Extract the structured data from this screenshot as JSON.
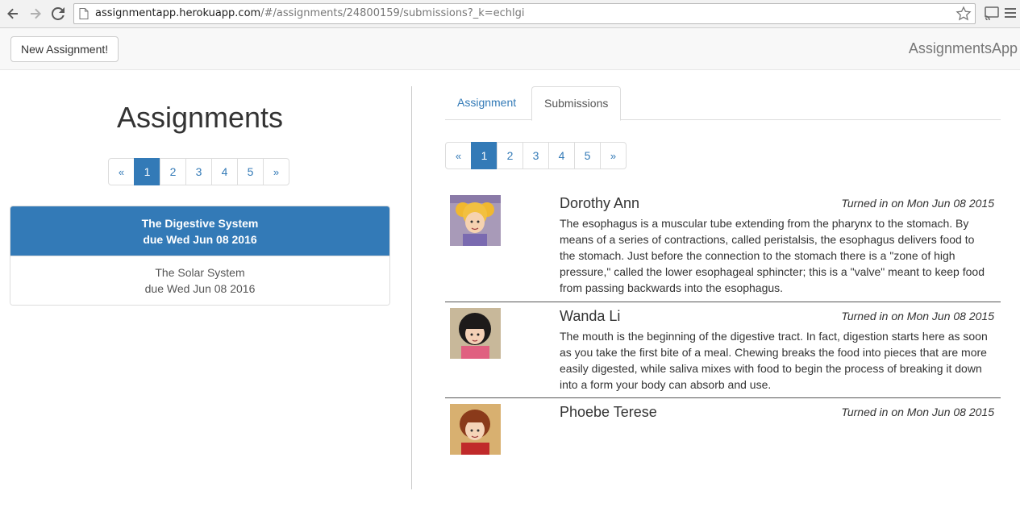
{
  "browser": {
    "url_host": "assignmentapp.herokuapp.com",
    "url_path": "/#/assignments/24800159/submissions?_k=echlgi"
  },
  "navbar": {
    "new_assignment_label": "New Assignment!",
    "brand": "AssignmentsApp"
  },
  "left": {
    "heading": "Assignments",
    "pagination": [
      "«",
      "1",
      "2",
      "3",
      "4",
      "5",
      "»"
    ],
    "active_page": "1",
    "assignments": [
      {
        "title": "The Digestive System",
        "due": "due Wed Jun 08 2016",
        "active": true
      },
      {
        "title": "The Solar System",
        "due": "due Wed Jun 08 2016",
        "active": false
      }
    ]
  },
  "right": {
    "tabs": [
      {
        "label": "Assignment",
        "active": false
      },
      {
        "label": "Submissions",
        "active": true
      }
    ],
    "pagination": [
      "«",
      "1",
      "2",
      "3",
      "4",
      "5",
      "»"
    ],
    "submissions": [
      {
        "name": "Dorothy Ann",
        "turned_in": "Turned in on Mon Jun 08 2015",
        "text_lines": [
          "The esophagus is a muscular tube extending from the pharynx to the stomach. By",
          "means of a series of contractions, called peristalsis, the esophagus delivers food to",
          "the stomach. Just before the connection to the stomach there is a \"zone of high",
          "pressure,\" called the lower esophageal sphincter; this is a \"valve\" meant to keep food",
          "from passing backwards into the esophagus."
        ]
      },
      {
        "name": "Wanda Li",
        "turned_in": "Turned in on Mon Jun 08 2015",
        "text_lines": [
          "The mouth is the beginning of the digestive tract. In fact, digestion starts here as soon",
          "as you take the first bite of a meal. Chewing breaks the food into pieces that are more",
          "easily digested, while saliva mixes with food to begin the process of breaking it down",
          "into a form your body can absorb and use."
        ]
      },
      {
        "name": "Phoebe Terese",
        "turned_in": "Turned in on Mon Jun 08 2015",
        "text_lines": []
      }
    ]
  },
  "colors": {
    "primary": "#337ab7",
    "navbar_bg": "#f8f8f8",
    "brand_text": "#777777"
  }
}
